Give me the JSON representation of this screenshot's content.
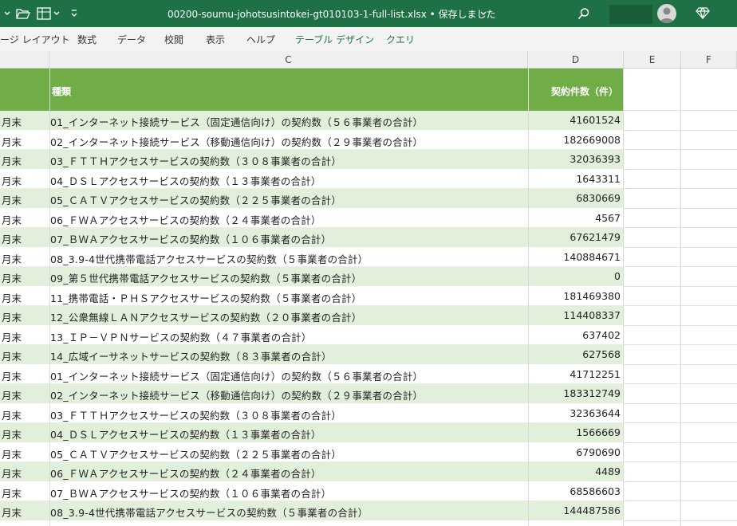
{
  "titlebar": {
    "title": "00200-soumu-johotsusintokei-gt010103-1-full-list.xlsx • 保存しました",
    "icons": [
      "chevron-down-icon",
      "folder-open-icon",
      "format-icon",
      "chevron-down-icon",
      "customize-icon",
      "search-icon",
      "avatar-icon",
      "diamond-icon"
    ]
  },
  "ribbon": {
    "tabs": [
      "ージ レイアウト",
      "数式",
      "データ",
      "校閲",
      "表示",
      "ヘルプ",
      "テーブル デザイン",
      "クエリ"
    ]
  },
  "columns": [
    "C",
    "D",
    "E",
    "F"
  ],
  "table": {
    "header": {
      "type": "種類",
      "count": "契約件数（件）"
    },
    "rows": [
      {
        "b": "月末",
        "c": "01_インターネット接続サービス（固定通信向け）の契約数（５６事業者の合計）",
        "d": "41601524"
      },
      {
        "b": "月末",
        "c": "02_インターネット接続サービス（移動通信向け）の契約数（２９事業者の合計）",
        "d": "182669008"
      },
      {
        "b": "月末",
        "c": "03_ＦＴＴＨアクセスサービスの契約数（３０８事業者の合計）",
        "d": "32036393"
      },
      {
        "b": "月末",
        "c": "04_ＤＳＬアクセスサービスの契約数（１３事業者の合計）",
        "d": "1643311"
      },
      {
        "b": "月末",
        "c": "05_ＣＡＴＶアクセスサービスの契約数（２２５事業者の合計）",
        "d": "6830669"
      },
      {
        "b": "月末",
        "c": "06_ＦＷＡアクセスサービスの契約数（２４事業者の合計）",
        "d": "4567"
      },
      {
        "b": "月末",
        "c": "07_ＢＷＡアクセスサービスの契約数（１０６事業者の合計）",
        "d": "67621479"
      },
      {
        "b": "月末",
        "c": "08_3.9-4世代携帯電話アクセスサービスの契約数（５事業者の合計）",
        "d": "140884671"
      },
      {
        "b": "月末",
        "c": "09_第５世代携帯電話アクセスサービスの契約数（５事業者の合計）",
        "d": "0"
      },
      {
        "b": "月末",
        "c": "11_携帯電話・ＰＨＳアクセスサービスの契約数（５事業者の合計）",
        "d": "181469380"
      },
      {
        "b": "月末",
        "c": "12_公衆無線ＬＡＮアクセスサービスの契約数（２０事業者の合計）",
        "d": "114408337"
      },
      {
        "b": "月末",
        "c": "13_ＩＰ－ＶＰＮサービスの契約数（４７事業者の合計）",
        "d": "637402"
      },
      {
        "b": "月末",
        "c": "14_広域イーサネットサービスの契約数（８３事業者の合計）",
        "d": "627568"
      },
      {
        "b": "月末",
        "c": "01_インターネット接続サービス（固定通信向け）の契約数（５６事業者の合計）",
        "d": "41712251"
      },
      {
        "b": "月末",
        "c": "02_インターネット接続サービス（移動通信向け）の契約数（２９事業者の合計）",
        "d": "183312749"
      },
      {
        "b": "月末",
        "c": "03_ＦＴＴＨアクセスサービスの契約数（３０８事業者の合計）",
        "d": "32363644"
      },
      {
        "b": "月末",
        "c": "04_ＤＳＬアクセスサービスの契約数（１３事業者の合計）",
        "d": "1566669"
      },
      {
        "b": "月末",
        "c": "05_ＣＡＴＶアクセスサービスの契約数（２２５事業者の合計）",
        "d": "6790690"
      },
      {
        "b": "月末",
        "c": "06_ＦＷＡアクセスサービスの契約数（２４事業者の合計）",
        "d": "4489"
      },
      {
        "b": "月末",
        "c": "07_ＢＷＡアクセスサービスの契約数（１０６事業者の合計）",
        "d": "68586603"
      },
      {
        "b": "月末",
        "c": "08_3.9-4世代携帯電話アクセスサービスの契約数（５事業者の合計）",
        "d": "144487586"
      }
    ]
  },
  "colors": {
    "titlebar": "#1e7145",
    "header_fill": "#70ad47",
    "band": "#e2efda"
  }
}
